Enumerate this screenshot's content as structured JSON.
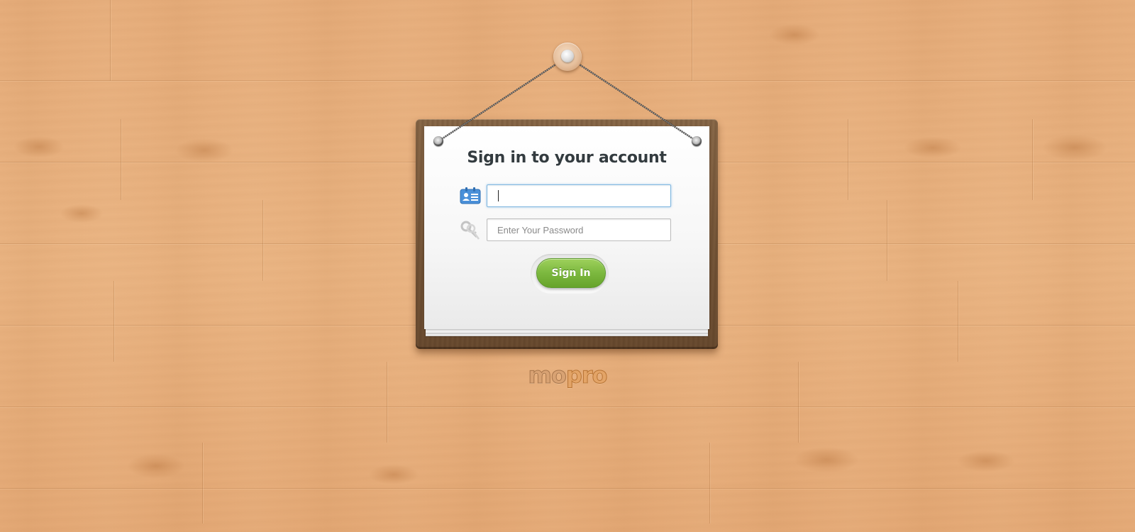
{
  "login": {
    "title": "Sign in to your account",
    "username": {
      "value": "",
      "placeholder": "",
      "icon": "id-card-icon"
    },
    "password": {
      "value": "",
      "placeholder": "Enter Your Password",
      "icon": "keys-icon"
    },
    "submit_label": "Sign In"
  },
  "brand": {
    "logo_part_a": "mo",
    "logo_part_b": "pro"
  },
  "colors": {
    "background_wood": "#e8b07f",
    "board_wood": "#7a5a3c",
    "button_green": "#7cb83f",
    "focus_blue": "#7fb7e0",
    "title_text": "#333b3f"
  }
}
